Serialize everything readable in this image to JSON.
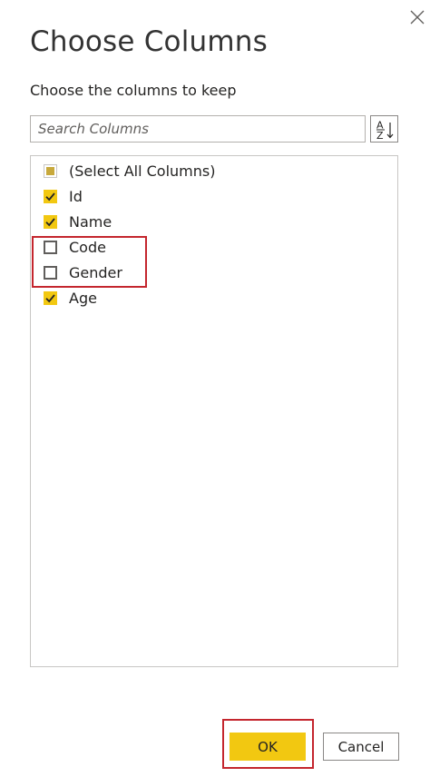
{
  "dialog": {
    "title": "Choose Columns",
    "subtitle": "Choose the columns to keep"
  },
  "search": {
    "placeholder": "Search Columns",
    "value": ""
  },
  "sort": {
    "icon": "sort-az-icon",
    "letter_top": "A",
    "letter_bottom": "Z"
  },
  "columns": [
    {
      "label": "(Select All Columns)",
      "state": "partial"
    },
    {
      "label": "Id",
      "state": "checked"
    },
    {
      "label": "Name",
      "state": "checked"
    },
    {
      "label": "Code",
      "state": "unchecked"
    },
    {
      "label": "Gender",
      "state": "unchecked"
    },
    {
      "label": "Age",
      "state": "checked"
    }
  ],
  "buttons": {
    "ok_label": "OK",
    "cancel_label": "Cancel"
  },
  "colors": {
    "accent": "#f2c811",
    "highlight": "#c4262e",
    "text": "#252423"
  }
}
